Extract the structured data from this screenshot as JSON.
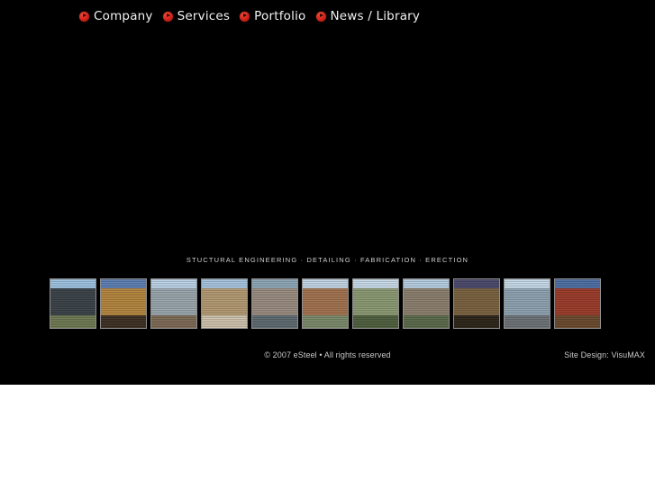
{
  "site": {
    "background_color": "#000000",
    "page_background_color": "#ffffff",
    "accent_color": "#d4221a"
  },
  "nav": {
    "items": [
      {
        "label": "Company",
        "icon": "red-arrow-bullet-icon"
      },
      {
        "label": "Services",
        "icon": "red-arrow-bullet-icon"
      },
      {
        "label": "Portfolio",
        "icon": "red-arrow-bullet-icon"
      },
      {
        "label": "News / Library",
        "icon": "red-arrow-bullet-icon"
      }
    ]
  },
  "tagline": {
    "text": "STUCTURAL ENGINEERING · DETAILING · FABRICATION · ERECTION"
  },
  "gallery": {
    "thumbnails": [
      {
        "alt": "dark glass office building",
        "sky": "#9fc4e2",
        "mid": "#3a4248",
        "ground": "#6f7a52"
      },
      {
        "alt": "domed civic building at dusk",
        "sky": "#5d7fb5",
        "mid": "#b5863f",
        "ground": "#3d2f22"
      },
      {
        "alt": "modern apartment complex",
        "sky": "#bcd4e8",
        "mid": "#9aa7ad",
        "ground": "#7d6a55"
      },
      {
        "alt": "classical stone building with columns",
        "sky": "#a8c6e0",
        "mid": "#b49a72",
        "ground": "#cfc4ae"
      },
      {
        "alt": "curved concrete structure over water",
        "sky": "#8fa8b8",
        "mid": "#9a8d80",
        "ground": "#5d6a70"
      },
      {
        "alt": "brick and white parking structure",
        "sky": "#c3d6e6",
        "mid": "#a2724f",
        "ground": "#7b8a6a"
      },
      {
        "alt": "park with bare trees",
        "sky": "#c9dcea",
        "mid": "#8b9a72",
        "ground": "#4f5f3e"
      },
      {
        "alt": "tall stone high-rise",
        "sky": "#b7cfe4",
        "mid": "#8c7f6d",
        "ground": "#5c6a4b"
      },
      {
        "alt": "stone arched building at night",
        "sky": "#4a4a6b",
        "mid": "#7a6240",
        "ground": "#2b2418"
      },
      {
        "alt": "glass and brick corner building",
        "sky": "#c8dbe9",
        "mid": "#8fa3b2",
        "ground": "#6d7278"
      },
      {
        "alt": "red roofed arena at dusk",
        "sky": "#4e6fa5",
        "mid": "#9c3b2a",
        "ground": "#6b4a2e"
      }
    ]
  },
  "footer": {
    "copyright": "© 2007 eSteel • All rights reserved",
    "credit": "Site Design: VisuMAX"
  }
}
